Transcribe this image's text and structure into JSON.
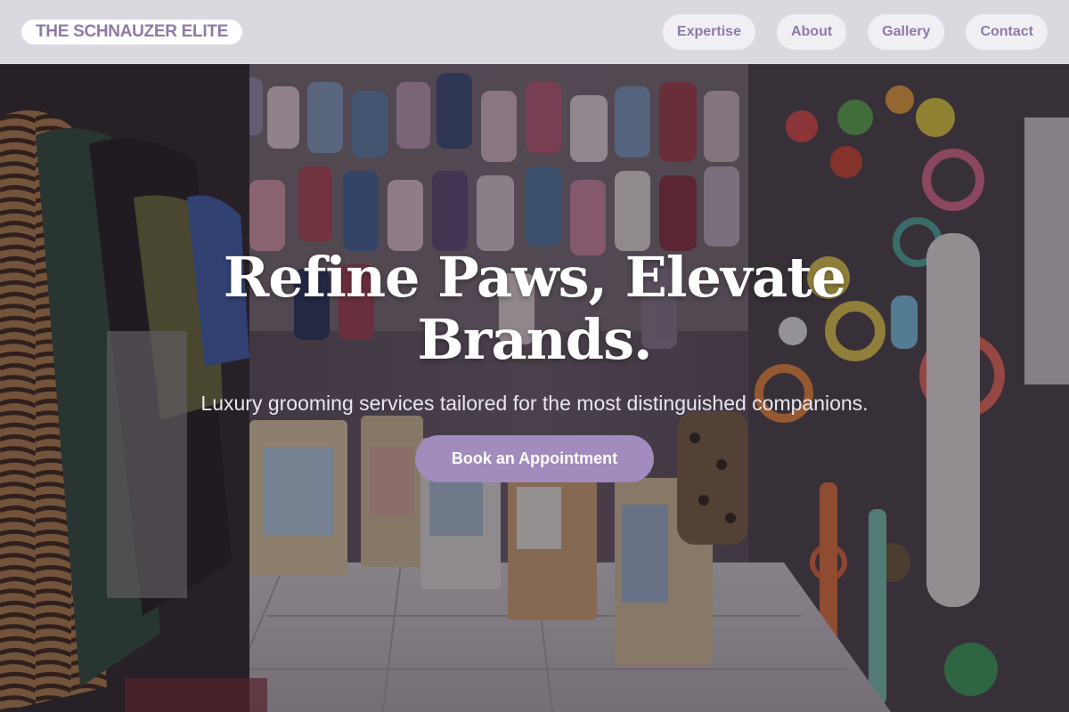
{
  "header": {
    "brand": "THE SCHNAUZER ELITE",
    "nav": [
      "Expertise",
      "About",
      "Gallery",
      "Contact"
    ]
  },
  "hero": {
    "title_line1": "Refine Paws, Elevate",
    "title_line2": "Brands.",
    "subtitle": "Luxury grooming services tailored for the most distinguished companions.",
    "cta_label": "Book an Appointment",
    "background_description_icon": "pet-shop-photo"
  },
  "colors": {
    "brand_purple": "#8f7aa8",
    "cta_purple": "#a28bbd",
    "header_bg": "#e2dee6",
    "nav_pill_bg": "#f2eff4"
  }
}
